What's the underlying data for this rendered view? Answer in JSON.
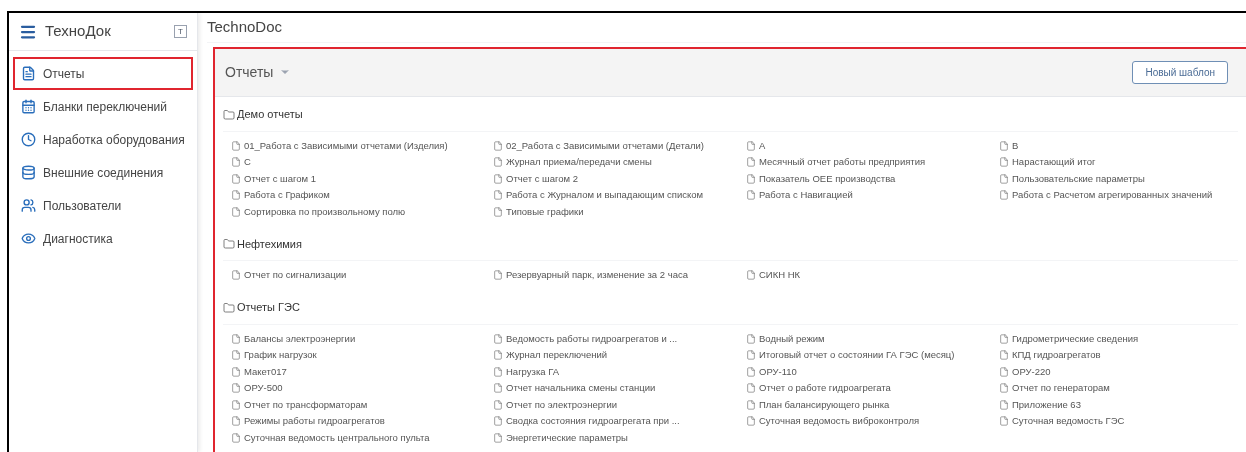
{
  "sidebar": {
    "title": "ТехноДок",
    "pin_label": "T",
    "items": [
      {
        "label": "Отчеты",
        "selected": true
      },
      {
        "label": "Бланки переключений",
        "selected": false
      },
      {
        "label": "Наработка оборудования",
        "selected": false
      },
      {
        "label": "Внешние соединения",
        "selected": false
      },
      {
        "label": "Пользователи",
        "selected": false
      },
      {
        "label": "Диагностика",
        "selected": false
      }
    ]
  },
  "main": {
    "title": "TechnoDoc",
    "panel": {
      "title": "Отчеты",
      "new_button": "Новый шаблон",
      "groups": [
        {
          "name": "Демо отчеты",
          "items": [
            "01_Работа с Зависимыми отчетами (Изделия)",
            "02_Работа с Зависимыми отчетами (Детали)",
            "A",
            "B",
            "C",
            "Журнал приема/передачи смены",
            "Месячный отчет работы предприятия",
            "Нарастающий итог",
            "Отчет с шагом 1",
            "Отчет с шагом 2",
            "Показатель OEE производства",
            "Пользовательские параметры",
            "Работа с Графиком",
            "Работа с Журналом и выпадающим списком",
            "Работа с Навигацией",
            "Работа с Расчетом агрегированных значений",
            "Сортировка по произвольному полю",
            "Типовые графики"
          ]
        },
        {
          "name": "Нефтехимия",
          "items": [
            "Отчет по сигнализации",
            "Резервуарный парк, изменение за 2 часа",
            "СИКН НК"
          ]
        },
        {
          "name": "Отчеты ГЭС",
          "items": [
            "Балансы электроэнергии",
            "Ведомость работы гидроагрегатов и ...",
            "Водный режим",
            "Гидрометрические сведения",
            "График нагрузок",
            "Журнал переключений",
            "Итоговый отчет о состоянии ГА ГЭС (месяц)",
            "КПД гидроагрегатов",
            "Макет017",
            "Нагрузка ГА",
            "ОРУ-110",
            "ОРУ-220",
            "ОРУ-500",
            "Отчет начальника смены станции",
            "Отчет о работе гидроагрегата",
            "Отчет по генераторам",
            "Отчет по трансформаторам",
            "Отчет по электроэнергии",
            "План балансирующего рынка",
            "Приложение 63",
            "Режимы работы гидроагрегатов",
            "Сводка состояния гидроагрегата при ...",
            "Суточная ведомость виброконтроля",
            "Суточная ведомость ГЭС",
            "Суточная ведомость центрального пульта",
            "Энергетические параметры"
          ]
        }
      ]
    }
  }
}
